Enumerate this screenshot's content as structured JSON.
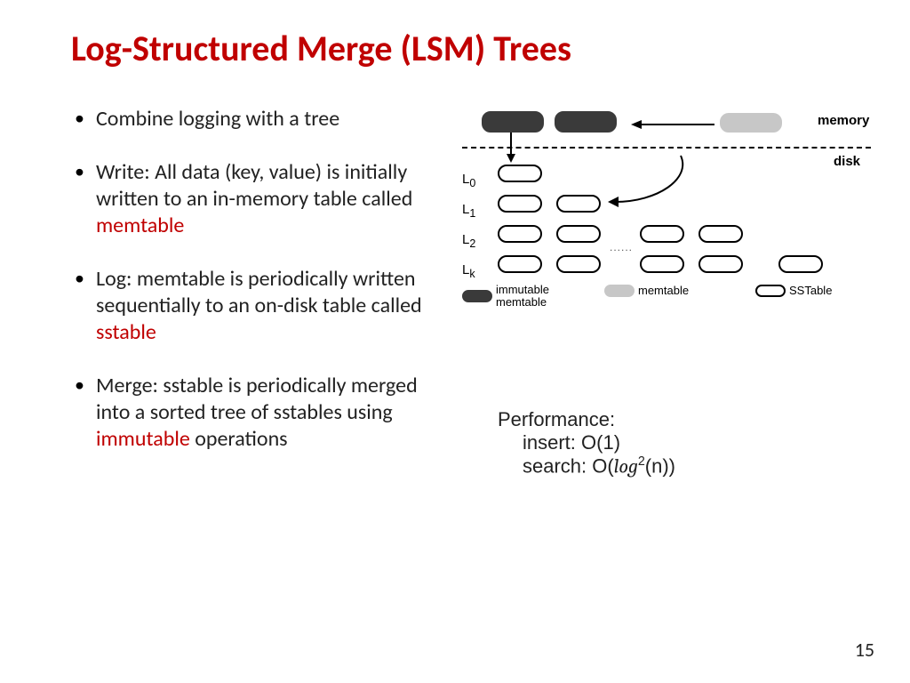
{
  "title": "Log-Structured Merge (LSM) Trees",
  "bullets": {
    "b1": "Combine logging with a tree",
    "b2a": "Write: All data (key, value) is initially written to an in-memory table called ",
    "b2kw": "memtable",
    "b3a": "Log: memtable is periodically written sequentially to an on-disk table called ",
    "b3kw": "sstable",
    "b4a": "Merge: sstable is periodically merged into a sorted tree of sstables using ",
    "b4kw": "immutable",
    "b4b": " operations"
  },
  "diagram": {
    "memory": "memory",
    "disk": "disk",
    "levels": {
      "L0": "L",
      "L0s": "0",
      "L1": "L",
      "L1s": "1",
      "L2": "L",
      "L2s": "2",
      "Lk": "L",
      "Lks": "k"
    },
    "legend": {
      "imm1": "immutable",
      "imm2": "memtable",
      "mem": "memtable",
      "sst": "SSTable"
    },
    "dots": "......"
  },
  "perf": {
    "header": "Performance:",
    "insert": "insert: O(1)",
    "search_a": "search: O(",
    "search_log": "log",
    "search_exp": "2",
    "search_b": "(n))"
  },
  "pagenum": "15"
}
